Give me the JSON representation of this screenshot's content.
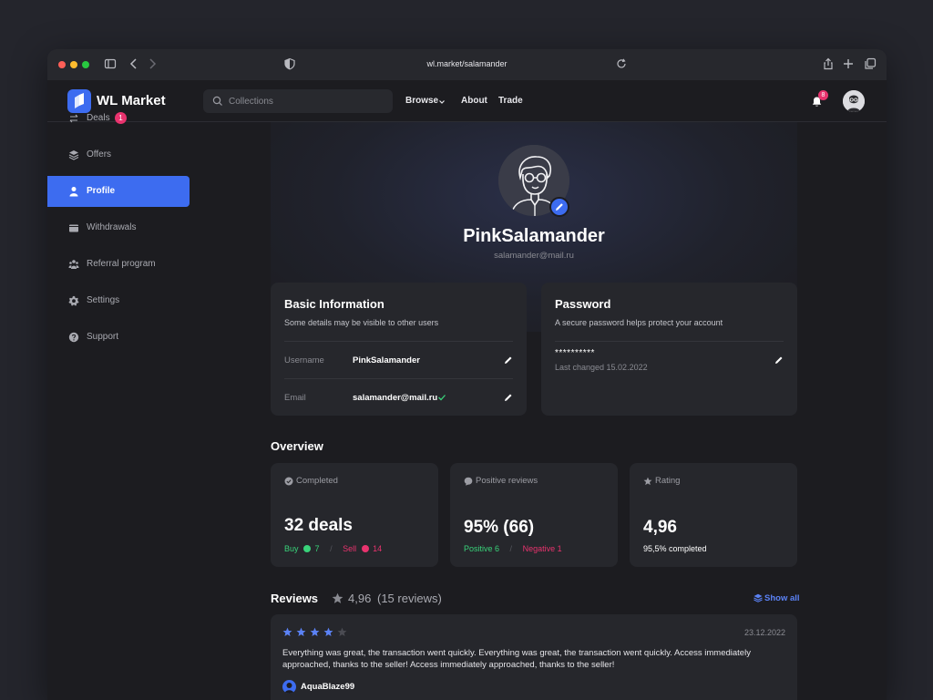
{
  "browser": {
    "url": "wl.market/salamander"
  },
  "header": {
    "brand": "WL Market",
    "search_placeholder": "Collections",
    "nav": [
      "Browse",
      "About",
      "Trade"
    ],
    "notifications_count": "8"
  },
  "sidebar": {
    "items": [
      {
        "label": "Deals",
        "icon": "swap-arrows-icon",
        "badge": "1"
      },
      {
        "label": "Offers",
        "icon": "layers-icon"
      },
      {
        "label": "Profile",
        "icon": "user-icon",
        "active": true
      },
      {
        "label": "Withdrawals",
        "icon": "wallet-icon"
      },
      {
        "label": "Referral program",
        "icon": "users-icon"
      },
      {
        "label": "Settings",
        "icon": "gear-icon"
      },
      {
        "label": "Support",
        "icon": "help-icon"
      }
    ]
  },
  "profile": {
    "name": "PinkSalamander",
    "email": "salamander@mail.ru"
  },
  "basic_info": {
    "title": "Basic Information",
    "subtitle": "Some details may be visible to other users",
    "username_label": "Username",
    "username_value": "PinkSalamander",
    "email_label": "Email",
    "email_value": "salamander@mail.ru"
  },
  "password": {
    "title": "Password",
    "subtitle": "A secure password helps protect your account",
    "masked": "**********",
    "last_changed": "Last changed 15.02.2022"
  },
  "overview": {
    "title": "Overview",
    "completed": {
      "label": "Completed",
      "value": "32 deals",
      "buy_label": "Buy",
      "buy_value": "7",
      "separator": "/",
      "sell_label": "Sell",
      "sell_value": "14"
    },
    "reviews": {
      "label": "Positive reviews",
      "value": "95% (66)",
      "positive": "Positive 6",
      "separator": "/",
      "negative": "Negative 1"
    },
    "rating": {
      "label": "Rating",
      "value": "4,96",
      "foot": "95,5% completed"
    }
  },
  "reviews_section": {
    "title": "Reviews",
    "rating": "4,96",
    "count": "(15 reviews)",
    "show_all": "Show all",
    "items": [
      {
        "stars": 4,
        "date": "23.12.2022",
        "text": "Everything was great, the transaction went quickly. Everything was great, the transaction went quickly. Access immediately approached, thanks to the seller! Access immediately approached, thanks to the seller!",
        "author": "AquaBlaze99"
      }
    ]
  },
  "colors": {
    "accent": "#3d6cf0",
    "badge": "#e8336e",
    "positive": "#39d37a",
    "negative": "#e8336e",
    "star": "#5b82f5"
  }
}
